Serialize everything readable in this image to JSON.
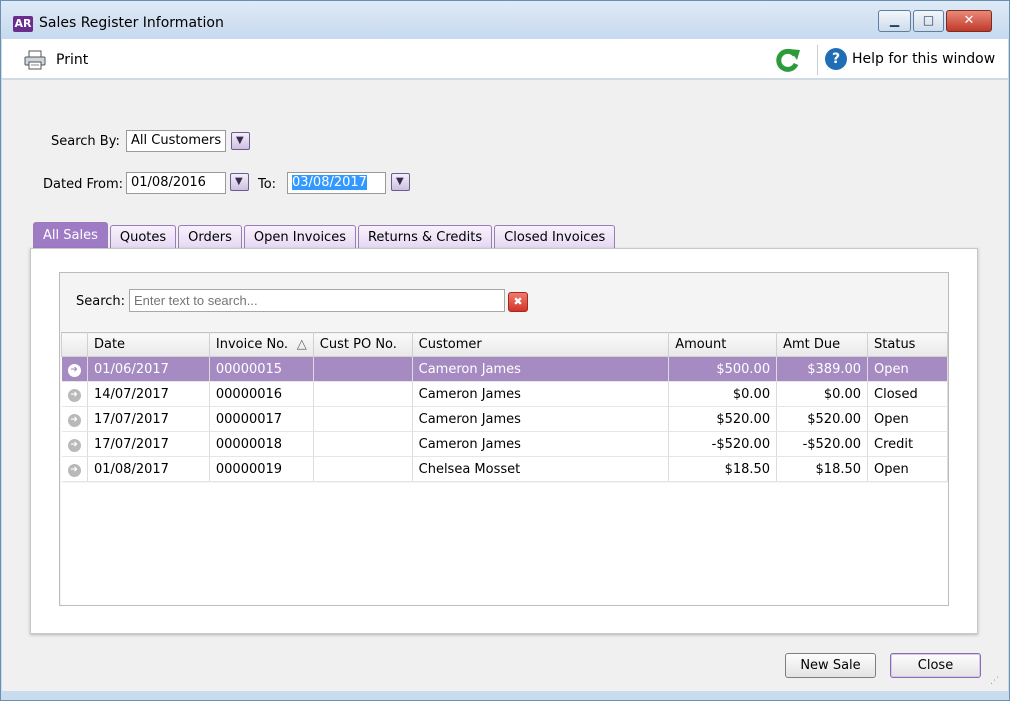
{
  "window": {
    "app_badge": "AR",
    "title": "Sales Register Information",
    "min_glyph": "▁",
    "max_glyph": "□",
    "close_glyph": "✕"
  },
  "toolbar": {
    "print_label": "Print",
    "help_glyph": "?",
    "help_label": "Help for this window"
  },
  "filters": {
    "search_by_label": "Search By:",
    "search_by_value": "All Customers",
    "dated_from_label": "Dated From:",
    "dated_from_value": "01/08/2016",
    "to_label": "To:",
    "to_value": "03/08/2017"
  },
  "tabs": [
    {
      "label": "All Sales",
      "active": true
    },
    {
      "label": "Quotes"
    },
    {
      "label": "Orders"
    },
    {
      "label": "Open Invoices"
    },
    {
      "label": "Returns & Credits"
    },
    {
      "label": "Closed Invoices"
    }
  ],
  "search": {
    "label": "Search:",
    "placeholder": "Enter text to search...",
    "clear_glyph": "✖"
  },
  "grid": {
    "columns": [
      "Date",
      "Invoice No.",
      "Cust PO No.",
      "Customer",
      "Amount",
      "Amt Due",
      "Status"
    ],
    "sort_glyph": "△",
    "rows": [
      {
        "date": "01/06/2017",
        "invoice": "00000015",
        "cust_po": "",
        "customer": "Cameron James",
        "amount": "$500.00",
        "amt_due": "$389.00",
        "status": "Open"
      },
      {
        "date": "14/07/2017",
        "invoice": "00000016",
        "cust_po": "",
        "customer": "Cameron James",
        "amount": "$0.00",
        "amt_due": "$0.00",
        "status": "Closed"
      },
      {
        "date": "17/07/2017",
        "invoice": "00000017",
        "cust_po": "",
        "customer": "Cameron James",
        "amount": "$520.00",
        "amt_due": "$520.00",
        "status": "Open"
      },
      {
        "date": "17/07/2017",
        "invoice": "00000018",
        "cust_po": "",
        "customer": "Cameron James",
        "amount": "-$520.00",
        "amt_due": "-$520.00",
        "status": "Credit"
      },
      {
        "date": "01/08/2017",
        "invoice": "00000019",
        "cust_po": "",
        "customer": "Chelsea Mosset",
        "amount": "$18.50",
        "amt_due": "$18.50",
        "status": "Open"
      }
    ],
    "row_glyph": "➜"
  },
  "buttons": {
    "new_sale": "New Sale",
    "close": "Close"
  },
  "colors": {
    "accent": "#9f7bc6",
    "selected_row": "#a68bc2",
    "refresh_green": "#2e9b3a",
    "help_blue": "#1f6eb5"
  }
}
